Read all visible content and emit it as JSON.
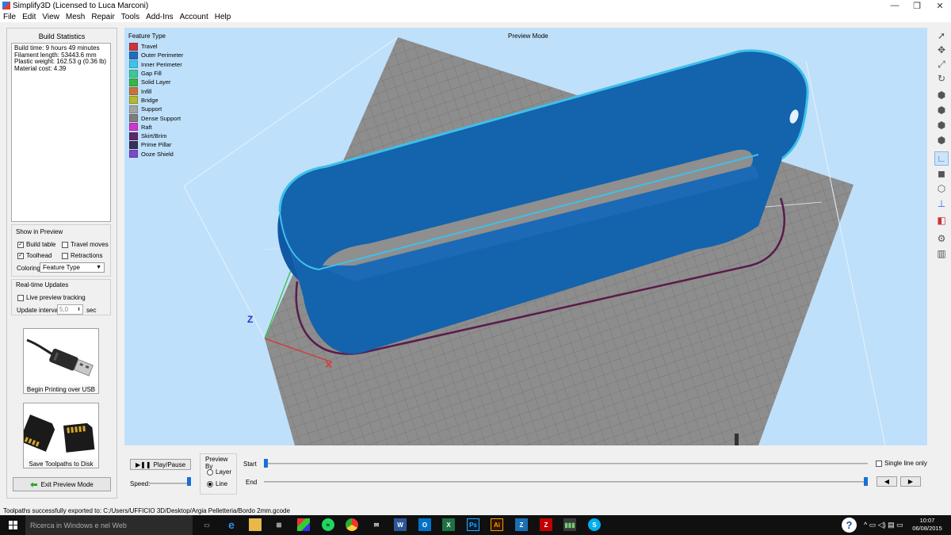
{
  "window": {
    "title": "Simplify3D (Licensed to Luca Marconi)"
  },
  "menu": [
    "File",
    "Edit",
    "View",
    "Mesh",
    "Repair",
    "Tools",
    "Add-Ins",
    "Account",
    "Help"
  ],
  "stats": {
    "title": "Build Statistics",
    "lines": [
      "Build time: 9 hours 49 minutes",
      "Filament length: 53443.6 mm",
      "Plastic weight: 162.53 g (0.36 lb)",
      "Material cost: 4.39"
    ]
  },
  "show_in_preview": {
    "title": "Show in Preview",
    "build_table": {
      "label": "Build table",
      "checked": true
    },
    "travel_moves": {
      "label": "Travel moves",
      "checked": false
    },
    "toolhead": {
      "label": "Toolhead",
      "checked": true
    },
    "retractions": {
      "label": "Retractions",
      "checked": false
    },
    "coloring_label": "Coloring",
    "coloring_value": "Feature Type"
  },
  "realtime": {
    "title": "Real-time Updates",
    "live_label": "Live preview tracking",
    "interval_label": "Update interval",
    "interval_value": "5,0",
    "interval_unit": "sec"
  },
  "buttons": {
    "usb": "Begin Printing over USB",
    "disk": "Save Toolpaths to Disk",
    "exit": "Exit Preview Mode"
  },
  "viewport": {
    "legend_title": "Feature Type",
    "mode_label": "Preview Mode",
    "legend": [
      {
        "name": "Travel",
        "color": "#c8343a"
      },
      {
        "name": "Outer Perimeter",
        "color": "#1e6fbf"
      },
      {
        "name": "Inner Perimeter",
        "color": "#3fc3e8"
      },
      {
        "name": "Gap Fill",
        "color": "#3fc79a"
      },
      {
        "name": "Solid Layer",
        "color": "#38b44a"
      },
      {
        "name": "Infill",
        "color": "#c6753a"
      },
      {
        "name": "Bridge",
        "color": "#b5b634"
      },
      {
        "name": "Support",
        "color": "#a4a4a4"
      },
      {
        "name": "Dense Support",
        "color": "#7d7d7d"
      },
      {
        "name": "Raft",
        "color": "#cc38cc"
      },
      {
        "name": "Skirt/Brim",
        "color": "#5a2a6a"
      },
      {
        "name": "Prime Pillar",
        "color": "#3a2f5a"
      },
      {
        "name": "Ooze Shield",
        "color": "#7a4ac8"
      }
    ]
  },
  "toolbar_icons": [
    "select-icon",
    "move-icon",
    "scale-icon",
    "rotate-icon",
    "view-default-icon",
    "view-front-icon",
    "view-side-icon",
    "view-top-icon",
    "axes-icon",
    "solid-view-icon",
    "wireframe-icon",
    "layer-icon",
    "cross-section-icon",
    "settings-icon",
    "delete-icon"
  ],
  "controls": {
    "play_label": "Play/Pause",
    "speed_label": "Speed:",
    "preview_by_title": "Preview By",
    "layer_label": "Layer",
    "line_label": "Line",
    "preview_by_selected": "Line",
    "start_label": "Start",
    "end_label": "End",
    "single_line_label": "Single line only",
    "speed_fraction": 1.0,
    "start_fraction": 0.0,
    "end_fraction": 1.0
  },
  "statusbar": {
    "text": "Toolpaths successfully exported to: C:/Users/UFFICIO 3D/Desktop/Argia Pelletteria/Bordo 2mm.gcode"
  },
  "taskbar": {
    "search_placeholder": "Ricerca in Windows e nel Web",
    "time": "10:07",
    "date": "06/08/2015",
    "apps": [
      "task-view-icon",
      "edge-icon",
      "explorer-icon",
      "store-icon",
      "photos-icon",
      "spotify-icon",
      "chrome-icon",
      "app-icon",
      "word-icon",
      "outlook-icon",
      "excel-icon",
      "photoshop-icon",
      "illustrator-icon",
      "z-icon",
      "filezilla-icon",
      "simplify3d-icon",
      "skype-icon"
    ]
  },
  "colors": {
    "viewport_bg": "#bfe0fa",
    "part_blue": "#1363ad",
    "part_edge": "#3ec0ea",
    "skirt": "#5a1b4a",
    "bed": "#8a8a8a"
  }
}
